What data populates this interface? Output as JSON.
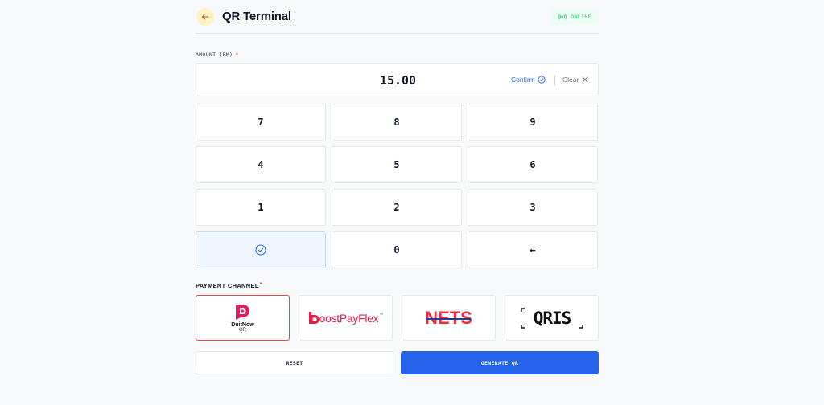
{
  "header": {
    "title": "QR Terminal",
    "status": "ONLINE",
    "accent": "#fef3c7",
    "status_color": "#22c55e"
  },
  "amount": {
    "label": "AMOUNT (RM)",
    "required_mark": "*",
    "value": "15.00",
    "confirm_label": "Confirm",
    "clear_label": "Clear"
  },
  "keypad": {
    "keys": [
      "7",
      "8",
      "9",
      "4",
      "5",
      "6",
      "1",
      "2",
      "3"
    ],
    "zero": "0",
    "backspace": "←"
  },
  "payment": {
    "label": "PAYMENT CHANNEL",
    "required_mark": "*",
    "selected": "duitnow",
    "channels": {
      "duitnow": {
        "name": "DuitNow",
        "sub": "QR"
      },
      "boost": {
        "text": "oostPayFlex",
        "tm": "™"
      },
      "nets": {
        "text": "NETS"
      },
      "qris": {
        "text": "QRIS"
      }
    }
  },
  "actions": {
    "reset_label": "RESET",
    "generate_label": "GENERATE QR",
    "primary_color": "#2563eb"
  }
}
